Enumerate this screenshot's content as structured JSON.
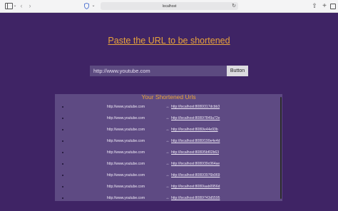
{
  "browser": {
    "address": "localhost",
    "icons": [
      "sidebar-icon",
      "back-icon",
      "forward-icon",
      "shield-icon",
      "reload-icon",
      "share-icon",
      "new-tab-icon",
      "tabs-overview-icon"
    ]
  },
  "page": {
    "headline": "Paste the URL to be shortened",
    "input_value": "http://www.youtube.com",
    "button_label": "Button",
    "list_title": "Your Shortened Urls",
    "arrow_glyph": "↔",
    "urls": [
      {
        "long": "http://www.youtube.com",
        "short": "http://localhost:8080/317dcbb3"
      },
      {
        "long": "http://www.youtube.com",
        "short": "http://localhost:8080/7849a72e"
      },
      {
        "long": "http://www.youtube.com",
        "short": "http://localhost:8080/e44e93b"
      },
      {
        "long": "http://www.youtube.com",
        "short": "http://localhost:8080/190e4e4d"
      },
      {
        "long": "http://www.youtube.com",
        "short": "http://localhost:8080/5bf02b63"
      },
      {
        "long": "http://www.youtube.com",
        "short": "http://localhost:8080/39c064ae"
      },
      {
        "long": "http://www.youtube.com",
        "short": "http://localhost:8080/3976b969"
      },
      {
        "long": "http://www.youtube.com",
        "short": "http://localhost:8080/aab0956d"
      },
      {
        "long": "http://www.youtube.com",
        "short": "http://localhost:8080/743d5595"
      }
    ]
  },
  "colors": {
    "background": "#3f2465",
    "accent": "#e8a33c",
    "panel": "#5e4a83",
    "input": "#5c4a80"
  }
}
